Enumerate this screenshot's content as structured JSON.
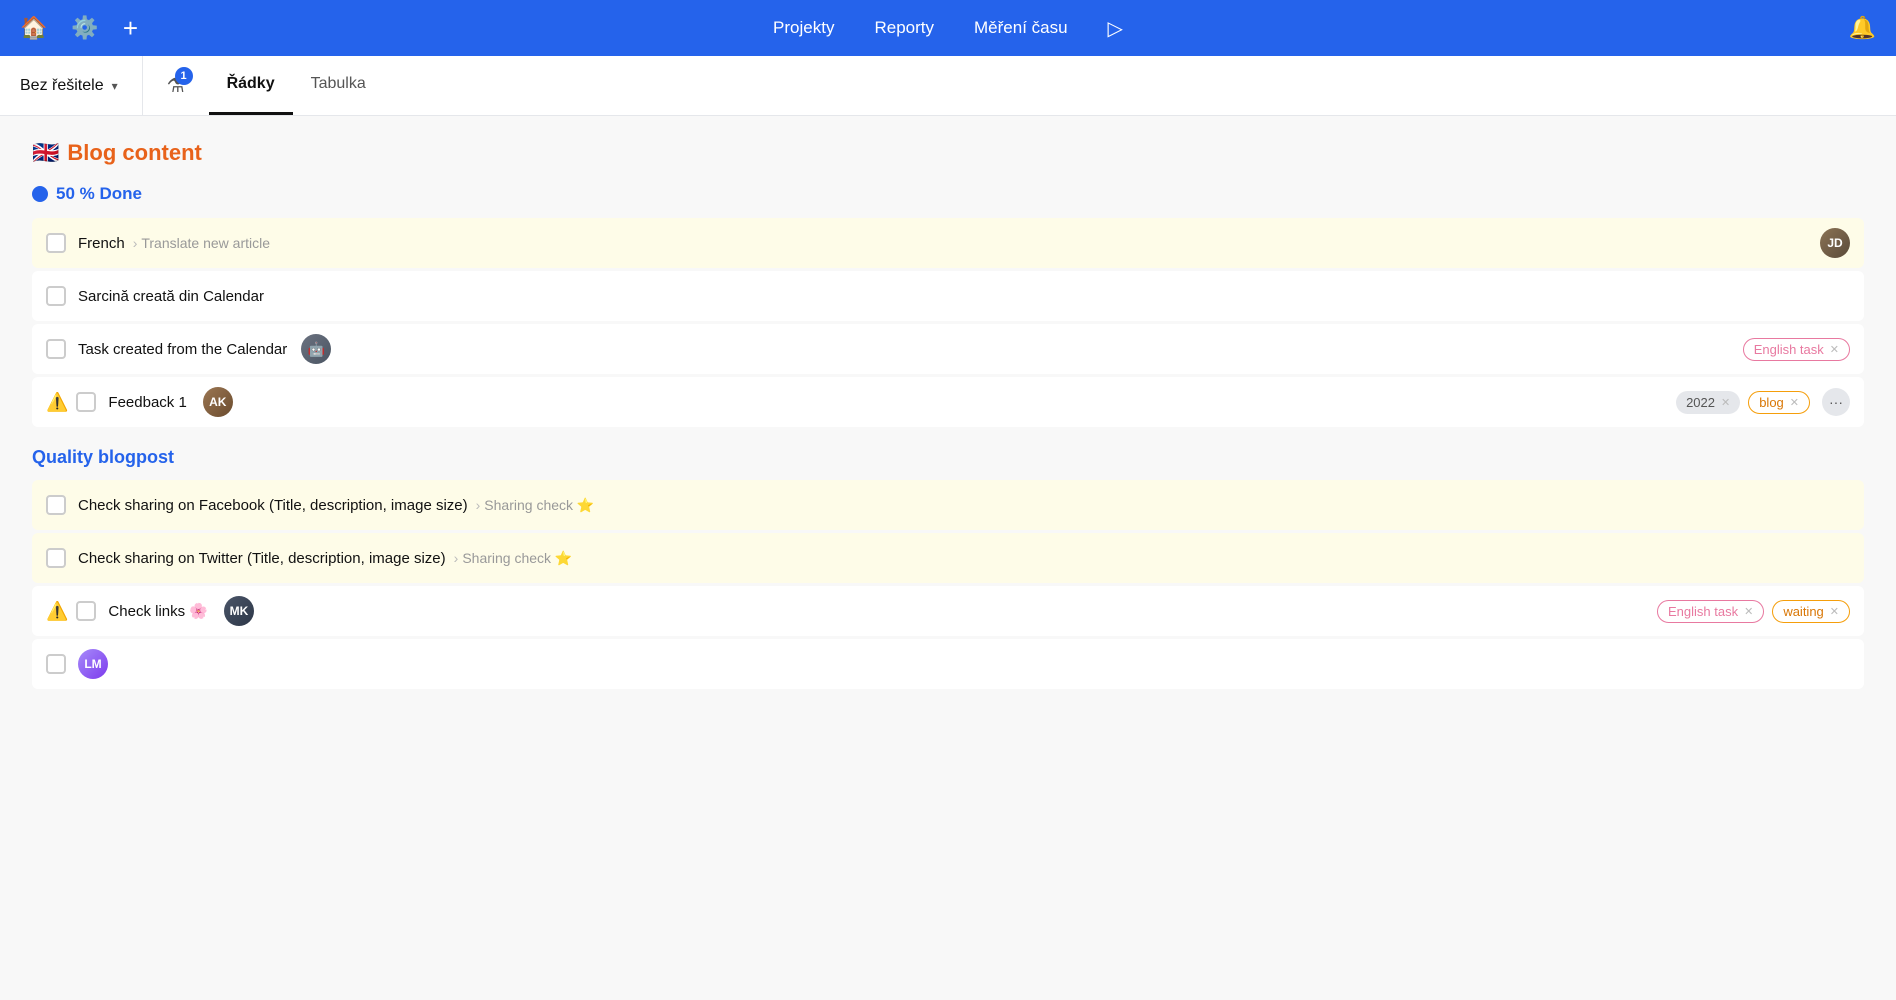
{
  "nav": {
    "home_icon": "🏠",
    "settings_icon": "⚙️",
    "add_icon": "+",
    "projekty": "Projekty",
    "reporty": "Reporty",
    "mereni_casu": "Měření času",
    "play_icon": "▷",
    "bell_icon": "🔔"
  },
  "subheader": {
    "assignee_label": "Bez řešitele",
    "filter_badge": "1",
    "tab_radky": "Řádky",
    "tab_tabulka": "Tabulka"
  },
  "sections": [
    {
      "id": "blog-content",
      "emoji": "🇬🇧",
      "title": "Blog content",
      "title_color": "orange",
      "groups": [
        {
          "id": "50-done",
          "dot_color": "#2563eb",
          "label": "50 % Done",
          "label_color": "blue",
          "tasks": [
            {
              "id": "french",
              "name": "French",
              "highlighted": true,
              "parent": "Translate new article",
              "has_avatar": true,
              "avatar_type": "person1",
              "tags": [],
              "has_warning": false
            },
            {
              "id": "sarcina",
              "name": "Sarcină creată din Calendar",
              "highlighted": false,
              "parent": null,
              "has_avatar": false,
              "tags": [],
              "has_warning": false
            },
            {
              "id": "task-calendar",
              "name": "Task created from the Calendar",
              "highlighted": false,
              "parent": null,
              "has_avatar": true,
              "avatar_type": "bot",
              "tags": [
                {
                  "type": "pink",
                  "label": "English task",
                  "has_x": true
                }
              ],
              "has_warning": false
            },
            {
              "id": "feedback1",
              "name": "Feedback 1",
              "highlighted": false,
              "parent": null,
              "has_avatar": true,
              "avatar_type": "person2",
              "tags": [
                {
                  "type": "gray-pill",
                  "label": "2022",
                  "has_x": true
                },
                {
                  "type": "orange",
                  "label": "blog",
                  "has_x": true
                }
              ],
              "has_warning": true,
              "has_dots": true
            }
          ]
        }
      ]
    },
    {
      "id": "quality-blogpost",
      "emoji": null,
      "title": "Quality blogpost",
      "title_color": "blue",
      "groups": [],
      "tasks": [
        {
          "id": "check-facebook",
          "name": "Check sharing on Facebook (Title, description, image size)",
          "highlighted": true,
          "parent": "Sharing check",
          "parent_emoji": "⭐",
          "has_avatar": false,
          "tags": [],
          "has_warning": false
        },
        {
          "id": "check-twitter",
          "name": "Check sharing on Twitter (Title, description, image size)",
          "highlighted": true,
          "parent": "Sharing check",
          "parent_emoji": "⭐",
          "has_avatar": false,
          "tags": [],
          "has_warning": false
        },
        {
          "id": "check-links",
          "name": "Check links",
          "highlighted": false,
          "emoji": "🌸",
          "has_avatar": true,
          "avatar_type": "person3",
          "tags": [
            {
              "type": "pink",
              "label": "English task",
              "has_x": true
            },
            {
              "type": "orange-waiting",
              "label": "waiting",
              "has_x": true
            }
          ],
          "has_warning": true
        },
        {
          "id": "task-bottom",
          "name": "",
          "highlighted": false,
          "has_avatar": true,
          "avatar_type": "person4",
          "tags": [],
          "has_warning": false,
          "partial": true
        }
      ]
    }
  ]
}
